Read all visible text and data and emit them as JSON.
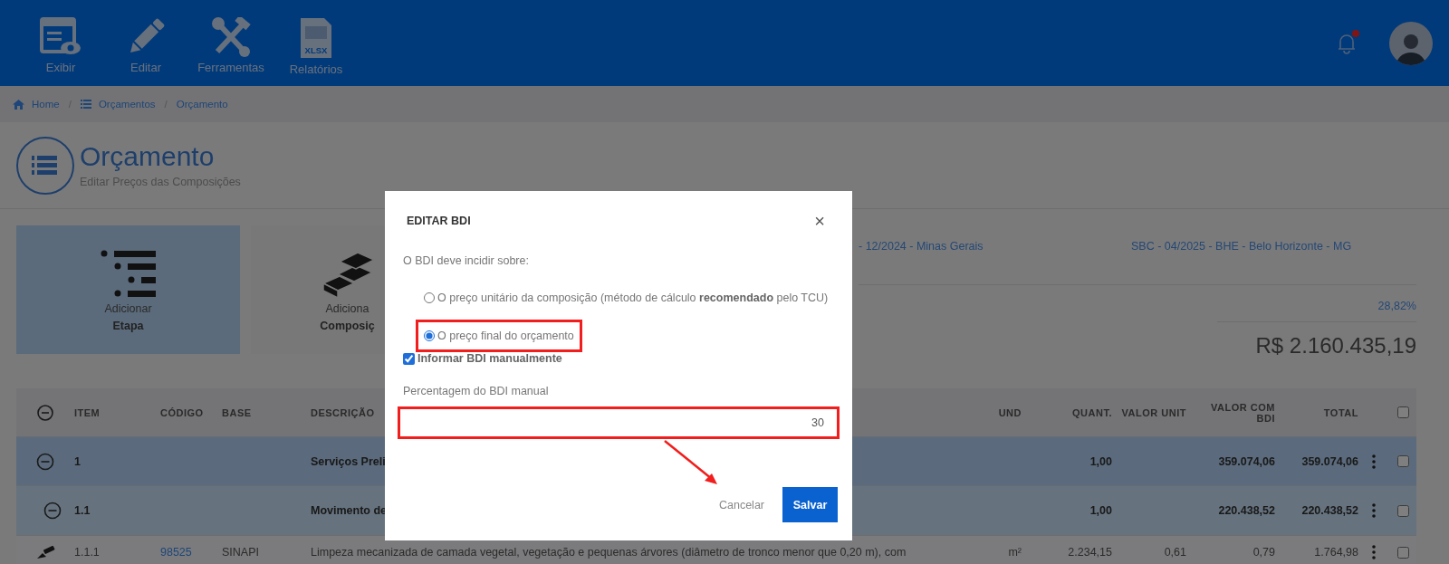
{
  "nav": [
    {
      "label": "Exibir",
      "kind": "view"
    },
    {
      "label": "Editar",
      "kind": "edit"
    },
    {
      "label": "Ferramentas",
      "kind": "tools"
    },
    {
      "label": "Relatórios",
      "kind": "reports",
      "badge": "XLSX"
    }
  ],
  "notifications": {
    "unread": true
  },
  "breadcrumb": [
    {
      "label": "Home",
      "kind": "home"
    },
    {
      "label": "Orçamentos",
      "kind": "list"
    },
    {
      "label": "Orçamento",
      "kind": "plain"
    }
  ],
  "breadcrumb_separator": "/",
  "page": {
    "title": "Orçamento",
    "subtitle": "Editar Preços das Composições"
  },
  "actions": [
    {
      "line1": "Adicionar",
      "line2": "Etapa",
      "kind": "stage",
      "selected": true
    },
    {
      "line1": "Adiciona",
      "line2": "Composiç",
      "kind": "composition",
      "selected": false
    }
  ],
  "info": {
    "reference_1": "- 12/2024 - Minas Gerais",
    "reference_2": "SBC - 04/2025 - BHE - Belo Horizonte - MG",
    "bdi": "28,82%",
    "total": "R$ 2.160.435,19"
  },
  "table": {
    "columns": [
      "ITEM",
      "CÓDIGO",
      "BASE",
      "DESCRIÇÃO",
      "UND",
      "QUANT.",
      "VALOR UNIT",
      "VALOR COM BDI",
      "TOTAL"
    ],
    "all_checked": false,
    "rows": [
      {
        "item": "1",
        "description": "Serviços Preli",
        "quantity": "1,00",
        "value_with_bdi": "359.074,06",
        "total": "359.074,06",
        "expanded": true,
        "checked": false,
        "children": [
          {
            "item": "1.1",
            "description": "Movimento de",
            "quantity": "1,00",
            "value_with_bdi": "220.438,52",
            "total": "220.438,52",
            "expanded": true,
            "checked": false,
            "children": [
              {
                "item": "1.1.1",
                "code": "98525",
                "base": "SINAPI",
                "description": "Limpeza mecanizada de camada vegetal, vegetação e pequenas árvores (diâmetro de tronco menor que 0,20 m), com",
                "unit": "m²",
                "quantity": "2.234,15",
                "unit_value": "0,61",
                "value_with_bdi": "0,79",
                "total": "1.764,98",
                "checked": false
              }
            ]
          }
        ]
      }
    ]
  },
  "dialog": {
    "title": "EDITAR BDI",
    "close": "×",
    "prompt": "O BDI deve incidir sobre:",
    "options": [
      {
        "label": "O preço unitário da composição (método de cálculo **recomendado** pelo TCU)",
        "selected": false,
        "highlighted": false
      },
      {
        "label": "O preço final do orçamento",
        "selected": true,
        "highlighted": true
      }
    ],
    "manual": {
      "label": "Informar BDI manualmente",
      "checked": true
    },
    "field": {
      "label": "Percentagem do BDI manual",
      "value": "30",
      "highlighted": true
    },
    "buttons": [
      {
        "label": "Cancelar",
        "kind": "secondary"
      },
      {
        "label": "Salvar",
        "kind": "primary"
      }
    ]
  }
}
